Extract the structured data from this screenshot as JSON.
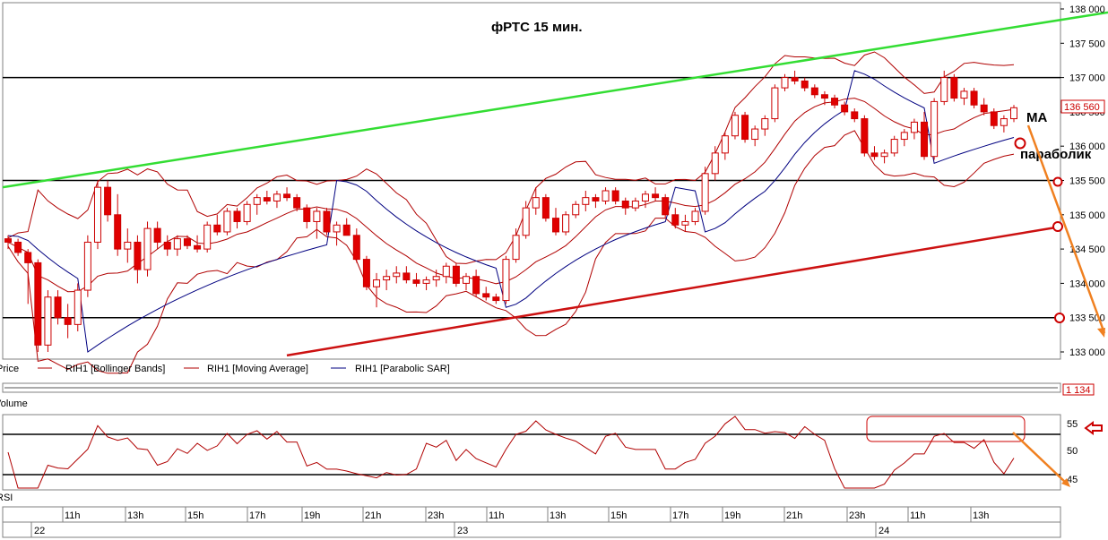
{
  "title": "фРТС   15 мин.",
  "annotations": {
    "ma": "MA",
    "parabolic": "параболик"
  },
  "legend": {
    "price": "Price",
    "bb": "RIH1 [Bollinger Bands]",
    "ma": "RIH1 [Moving Average]",
    "sar": "RIH1 [Parabolic SAR]"
  },
  "volume": {
    "label": "Volume",
    "value": "1 134"
  },
  "rsi": {
    "label": "RSI",
    "ticks": [
      "55",
      "50",
      "45"
    ]
  },
  "colors": {
    "up": "#ffffff",
    "down": "#e00000",
    "candle_border": "#cc0000",
    "bb": "#b00000",
    "ma": "#b00000",
    "sar": "#000080",
    "green_trend": "#33dd33",
    "red_trend": "#cc1111",
    "level": "#000000",
    "arrow": "#f08020",
    "grid": "#c0c0c0"
  },
  "chart_data": {
    "type": "candlestick",
    "price_axis": {
      "ylim": [
        133000,
        138000
      ],
      "ticks": [
        "133 000",
        "133 500",
        "134 000",
        "134 500",
        "135 000",
        "135 500",
        "136 000",
        "136 500",
        "137 000",
        "137 500",
        "138 000"
      ],
      "last_price": "136 560"
    },
    "levels": [
      137000,
      135500,
      133500
    ],
    "time_axis": {
      "hours": [
        "11h",
        "13h",
        "15h",
        "17h",
        "19h",
        "21h",
        "23h",
        "11h",
        "13h",
        "15h",
        "17h",
        "19h",
        "21h",
        "23h",
        "11h",
        "13h"
      ],
      "days": [
        "22",
        "23",
        "24"
      ]
    },
    "candles": [
      [
        134650,
        134700,
        134500,
        134600
      ],
      [
        134600,
        134650,
        134400,
        134450
      ],
      [
        134450,
        134500,
        133700,
        134300
      ],
      [
        134300,
        134350,
        133000,
        133100
      ],
      [
        133100,
        133900,
        133000,
        133800
      ],
      [
        133800,
        133900,
        133400,
        133500
      ],
      [
        133500,
        133700,
        133200,
        133400
      ],
      [
        133400,
        134000,
        133300,
        133900
      ],
      [
        133900,
        134700,
        133800,
        134600
      ],
      [
        134600,
        135500,
        134500,
        135400
      ],
      [
        135400,
        135500,
        134900,
        135000
      ],
      [
        135000,
        135300,
        134400,
        134500
      ],
      [
        134500,
        134800,
        134300,
        134600
      ],
      [
        134600,
        134700,
        134000,
        134200
      ],
      [
        134200,
        134900,
        134100,
        134800
      ],
      [
        134800,
        134900,
        134500,
        134600
      ],
      [
        134600,
        134700,
        134400,
        134500
      ],
      [
        134500,
        134700,
        134400,
        134650
      ],
      [
        134650,
        134700,
        134500,
        134550
      ],
      [
        134550,
        134700,
        134450,
        134500
      ],
      [
        134500,
        134900,
        134450,
        134850
      ],
      [
        134850,
        135000,
        134700,
        134750
      ],
      [
        134750,
        135100,
        134700,
        135050
      ],
      [
        135050,
        135100,
        134800,
        134900
      ],
      [
        134900,
        135200,
        134850,
        135150
      ],
      [
        135150,
        135300,
        135000,
        135250
      ],
      [
        135250,
        135350,
        135150,
        135200
      ],
      [
        135200,
        135350,
        135100,
        135300
      ],
      [
        135300,
        135400,
        135200,
        135250
      ],
      [
        135250,
        135300,
        135050,
        135100
      ],
      [
        135100,
        135150,
        134800,
        134900
      ],
      [
        134900,
        135100,
        134650,
        135050
      ],
      [
        135050,
        135100,
        134700,
        134750
      ],
      [
        134750,
        134900,
        134550,
        134850
      ],
      [
        134850,
        134950,
        134700,
        134700
      ],
      [
        134700,
        134800,
        134300,
        134350
      ],
      [
        134350,
        134400,
        133900,
        133950
      ],
      [
        133950,
        134150,
        133650,
        134050
      ],
      [
        134050,
        134200,
        133900,
        134100
      ],
      [
        134100,
        134250,
        134000,
        134150
      ],
      [
        134150,
        134250,
        134000,
        134050
      ],
      [
        134050,
        134150,
        133950,
        134000
      ],
      [
        134000,
        134100,
        133900,
        134050
      ],
      [
        134050,
        134200,
        133950,
        134100
      ],
      [
        134100,
        134300,
        134000,
        134250
      ],
      [
        134250,
        134300,
        133950,
        134000
      ],
      [
        134000,
        134150,
        133900,
        134100
      ],
      [
        134100,
        134200,
        133800,
        133850
      ],
      [
        133850,
        133950,
        133750,
        133800
      ],
      [
        133800,
        133850,
        133700,
        133750
      ],
      [
        133750,
        134400,
        133700,
        134350
      ],
      [
        134350,
        134800,
        134300,
        134700
      ],
      [
        134700,
        135200,
        134650,
        135100
      ],
      [
        135100,
        135400,
        135000,
        135250
      ],
      [
        135250,
        135300,
        134900,
        134950
      ],
      [
        134950,
        135100,
        134700,
        134750
      ],
      [
        134750,
        135050,
        134700,
        135000
      ],
      [
        135000,
        135200,
        134950,
        135150
      ],
      [
        135150,
        135350,
        135050,
        135250
      ],
      [
        135250,
        135300,
        135100,
        135200
      ],
      [
        135200,
        135400,
        135150,
        135350
      ],
      [
        135350,
        135400,
        135150,
        135200
      ],
      [
        135200,
        135250,
        135000,
        135100
      ],
      [
        135100,
        135250,
        135050,
        135200
      ],
      [
        135200,
        135350,
        135100,
        135300
      ],
      [
        135300,
        135400,
        135200,
        135250
      ],
      [
        135250,
        135300,
        134950,
        135000
      ],
      [
        135000,
        135100,
        134800,
        134850
      ],
      [
        134850,
        135000,
        134750,
        134900
      ],
      [
        134900,
        135100,
        134850,
        135050
      ],
      [
        135050,
        135700,
        135000,
        135600
      ],
      [
        135600,
        136000,
        135500,
        135900
      ],
      [
        135900,
        136200,
        135800,
        136150
      ],
      [
        136150,
        136500,
        136100,
        136450
      ],
      [
        136450,
        136500,
        136050,
        136100
      ],
      [
        136100,
        136300,
        136000,
        136250
      ],
      [
        136250,
        136450,
        136150,
        136400
      ],
      [
        136400,
        136900,
        136350,
        136850
      ],
      [
        136850,
        137050,
        136800,
        137000
      ],
      [
        137000,
        137100,
        136900,
        136950
      ],
      [
        136950,
        137000,
        136800,
        136850
      ],
      [
        136850,
        136900,
        136700,
        136750
      ],
      [
        136750,
        136800,
        136600,
        136700
      ],
      [
        136700,
        136750,
        136550,
        136600
      ],
      [
        136600,
        136650,
        136450,
        136500
      ],
      [
        136500,
        136550,
        136350,
        136400
      ],
      [
        136400,
        136450,
        135850,
        135900
      ],
      [
        135900,
        136000,
        135800,
        135850
      ],
      [
        135850,
        135950,
        135750,
        135900
      ],
      [
        135900,
        136150,
        135850,
        136100
      ],
      [
        136100,
        136250,
        136000,
        136200
      ],
      [
        136200,
        136400,
        136100,
        136350
      ],
      [
        136350,
        136500,
        135800,
        135850
      ],
      [
        135850,
        136700,
        135800,
        136650
      ],
      [
        136650,
        137100,
        136600,
        137000
      ],
      [
        137000,
        137050,
        136650,
        136700
      ],
      [
        136700,
        136850,
        136600,
        136800
      ],
      [
        136800,
        136850,
        136550,
        136600
      ],
      [
        136600,
        136700,
        136450,
        136500
      ],
      [
        136500,
        136550,
        136250,
        136300
      ],
      [
        136300,
        136450,
        136200,
        136400
      ],
      [
        136400,
        136600,
        136350,
        136560
      ]
    ]
  }
}
